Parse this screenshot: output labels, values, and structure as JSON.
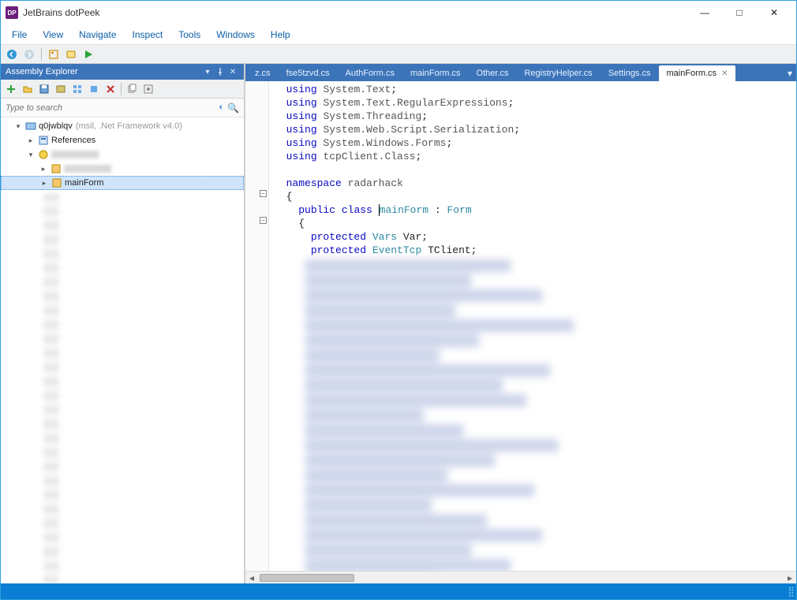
{
  "window": {
    "title": "JetBrains dotPeek",
    "app_icon_text": "DP"
  },
  "win_controls": {
    "min": "—",
    "max": "□",
    "close": "✕"
  },
  "menubar": [
    "File",
    "View",
    "Navigate",
    "Inspect",
    "Tools",
    "Windows",
    "Help"
  ],
  "panel": {
    "title": "Assembly Explorer",
    "search_placeholder": "Type to search"
  },
  "tree": {
    "root": {
      "label": "q0jwblqv",
      "meta": "(msil, .Net Framework v4.0)"
    },
    "references_label": "References",
    "mainform_label": "mainForm"
  },
  "tabs": {
    "items": [
      "z.cs",
      "fse5tzvd.cs",
      "AuthForm.cs",
      "mainForm.cs",
      "Other.cs",
      "RegistryHelper.cs",
      "Settings.cs",
      "mainForm.cs"
    ],
    "active_index": 7
  },
  "code": {
    "usings": [
      "System.Text",
      "System.Text.RegularExpressions",
      "System.Threading",
      "System.Web.Script.Serialization",
      "System.Windows.Forms",
      "tcpClient.Class"
    ],
    "namespace_kw": "namespace",
    "namespace_name": "radarhack",
    "public_kw": "public",
    "class_kw": "class",
    "class_name": "mainForm",
    "base_sep": " : ",
    "base_name": "Form",
    "protected_kw": "protected",
    "field1_type": "Vars",
    "field1_name": "Var",
    "field2_type": "EventTcp",
    "field2_name": "TClient",
    "using_kw": "using",
    "brace_open": "{",
    "brace_close": "}",
    "semi": ";"
  }
}
